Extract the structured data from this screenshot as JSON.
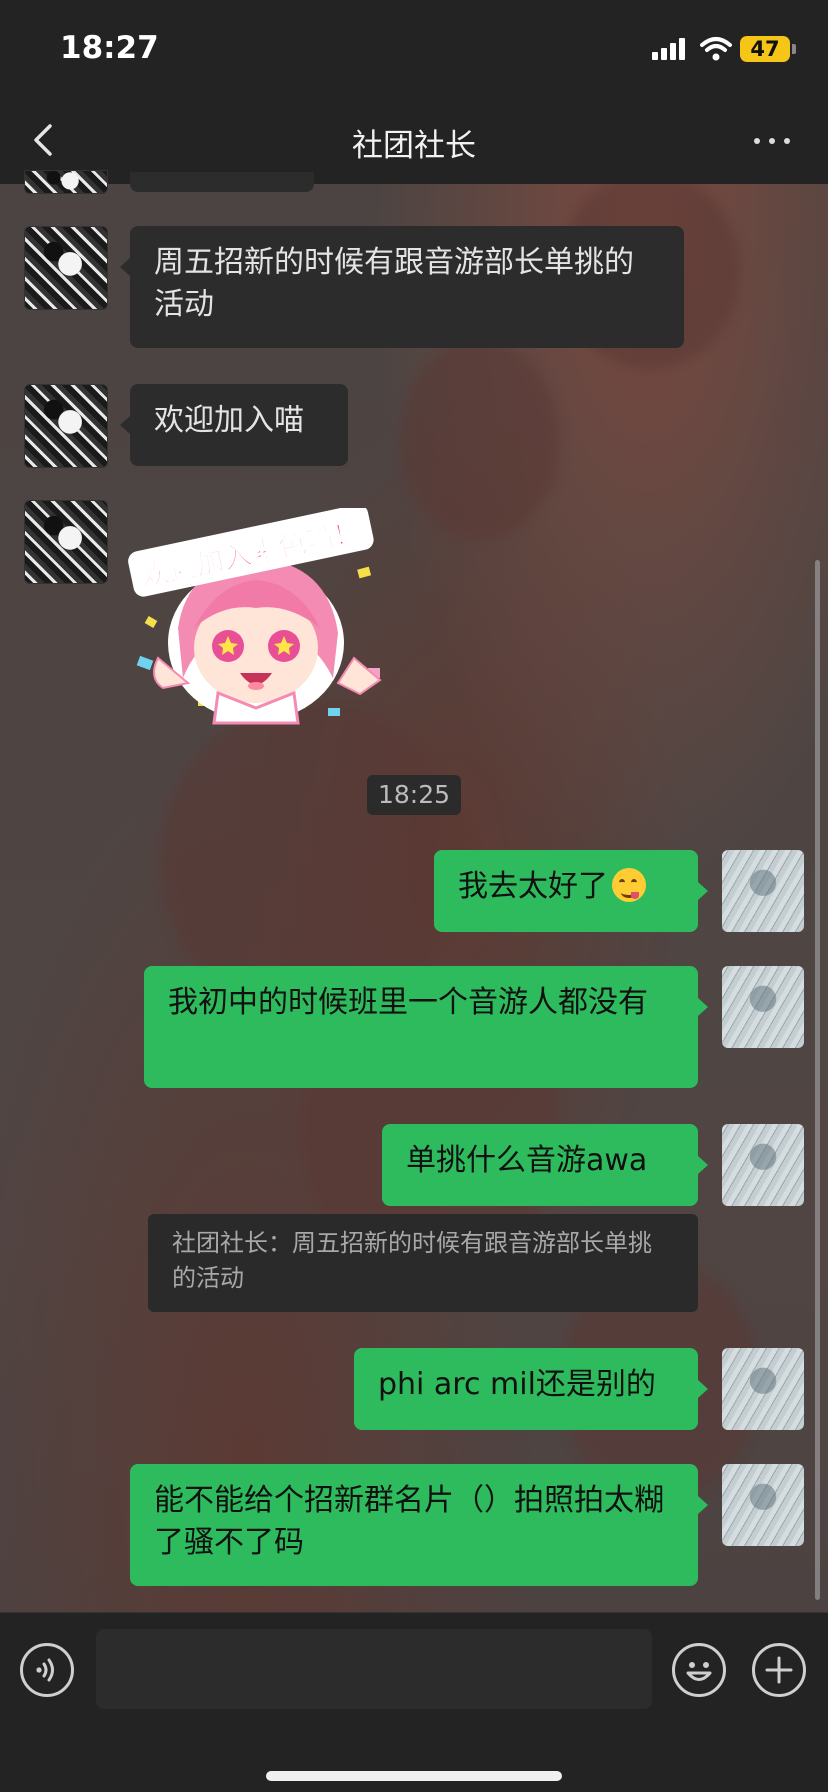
{
  "status_bar": {
    "time": "18:27",
    "battery": "47",
    "signal_icon": "cellular-signal-icon",
    "wifi_icon": "wifi-icon",
    "battery_color": "#f5c518"
  },
  "nav": {
    "title": "社团社长",
    "back_icon": "chevron-left-icon",
    "more_icon": "more-dots-icon"
  },
  "messages": [
    {
      "side": "left",
      "text": "周五招新的时候有跟音游部长单挑的活动"
    },
    {
      "side": "left",
      "text": "欢迎加入喵"
    },
    {
      "side": "left",
      "type": "sticker",
      "text": "欢迎加入素色喵！"
    }
  ],
  "time_divider": "18:25",
  "my_messages": [
    {
      "side": "right",
      "text": "我去太好了",
      "emoji": "tongue-out-face-emoji"
    },
    {
      "side": "right",
      "text": "我初中的时候班里一个音游人都没有"
    },
    {
      "side": "right",
      "text": "单挑什么音游awa"
    },
    {
      "side": "right",
      "text": "phi arc mil还是别的"
    },
    {
      "side": "right",
      "text": "能不能给个招新群名片（）拍照拍太糊了骚不了码"
    }
  ],
  "quote": "社团社长：周五招新的时候有跟音游部长单挑的活动",
  "input_bar": {
    "voice_icon": "voice-icon",
    "emoji_icon": "smiley-icon",
    "plus_icon": "plus-icon",
    "placeholder": ""
  },
  "colors": {
    "my_bubble": "#2dbb5d",
    "their_bubble": "#2c2c2c",
    "bar_background": "#232323"
  }
}
